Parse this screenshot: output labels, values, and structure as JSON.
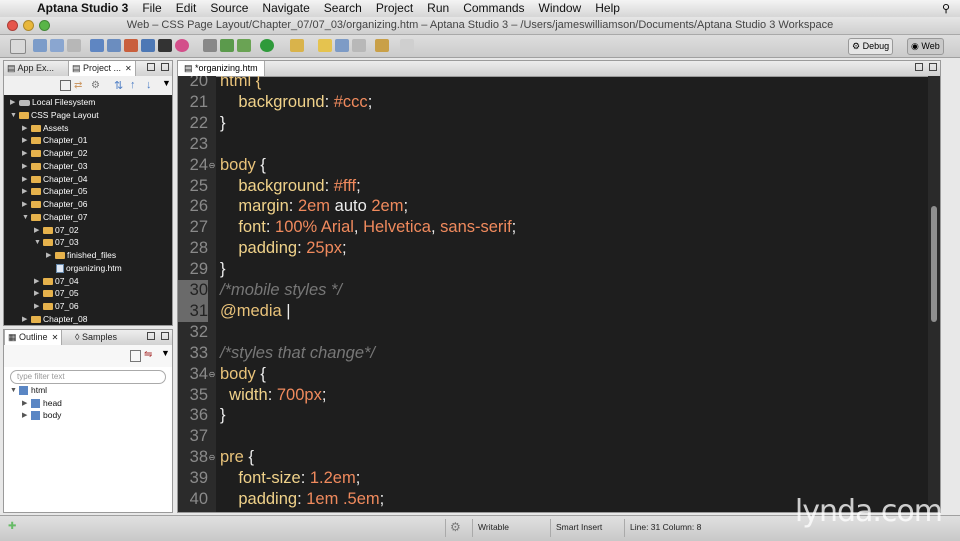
{
  "menubar": {
    "app_name": "Aptana Studio 3",
    "items": [
      "File",
      "Edit",
      "Source",
      "Navigate",
      "Search",
      "Project",
      "Run",
      "Commands",
      "Window",
      "Help"
    ]
  },
  "window": {
    "title": "Web – CSS Page Layout/Chapter_07/07_03/organizing.htm – Aptana Studio 3 – /Users/jameswilliamson/Documents/Aptana Studio 3 Workspace"
  },
  "perspectives": {
    "debug_label": "Debug",
    "web_label": "Web"
  },
  "left_panel": {
    "tabs": [
      {
        "label": "App Ex..."
      },
      {
        "label": "Project ..."
      }
    ],
    "tree": [
      {
        "label": "Local Filesystem",
        "type": "drive",
        "indent": 0,
        "arrow": "▶"
      },
      {
        "label": "CSS Page Layout",
        "type": "project",
        "indent": 0,
        "arrow": "▼"
      },
      {
        "label": "Assets",
        "type": "folder",
        "indent": 1,
        "arrow": "▶"
      },
      {
        "label": "Chapter_01",
        "type": "folder",
        "indent": 1,
        "arrow": "▶"
      },
      {
        "label": "Chapter_02",
        "type": "folder",
        "indent": 1,
        "arrow": "▶"
      },
      {
        "label": "Chapter_03",
        "type": "folder",
        "indent": 1,
        "arrow": "▶"
      },
      {
        "label": "Chapter_04",
        "type": "folder",
        "indent": 1,
        "arrow": "▶"
      },
      {
        "label": "Chapter_05",
        "type": "folder",
        "indent": 1,
        "arrow": "▶"
      },
      {
        "label": "Chapter_06",
        "type": "folder",
        "indent": 1,
        "arrow": "▶"
      },
      {
        "label": "Chapter_07",
        "type": "folder",
        "indent": 1,
        "arrow": "▼"
      },
      {
        "label": "07_02",
        "type": "folder",
        "indent": 2,
        "arrow": "▶"
      },
      {
        "label": "07_03",
        "type": "folder",
        "indent": 2,
        "arrow": "▼"
      },
      {
        "label": "finished_files",
        "type": "folder",
        "indent": 3,
        "arrow": "▶"
      },
      {
        "label": "organizing.htm",
        "type": "file",
        "indent": 3,
        "arrow": ""
      },
      {
        "label": "07_04",
        "type": "folder",
        "indent": 2,
        "arrow": "▶"
      },
      {
        "label": "07_05",
        "type": "folder",
        "indent": 2,
        "arrow": "▶"
      },
      {
        "label": "07_06",
        "type": "folder",
        "indent": 2,
        "arrow": "▶"
      },
      {
        "label": "Chapter_08",
        "type": "folder",
        "indent": 1,
        "arrow": "▶"
      }
    ]
  },
  "outline_panel": {
    "tabs": [
      {
        "label": "Outline"
      },
      {
        "label": "Samples"
      }
    ],
    "filter_placeholder": "type filter text",
    "tree": [
      {
        "label": "html",
        "indent": 0,
        "arrow": "▼"
      },
      {
        "label": "head",
        "indent": 1,
        "arrow": "▶"
      },
      {
        "label": "body",
        "indent": 1,
        "arrow": "▶"
      }
    ]
  },
  "editor": {
    "tab_label": "*organizing.htm",
    "lines": [
      {
        "num": "20",
        "fold": "",
        "tokens": [
          {
            "t": "html {",
            "c": "c-sel"
          }
        ]
      },
      {
        "num": "21",
        "fold": "",
        "tokens": [
          {
            "t": "    background",
            "c": "c-prop"
          },
          {
            "t": ": ",
            "c": ""
          },
          {
            "t": "#ccc",
            "c": "c-val"
          },
          {
            "t": ";",
            "c": ""
          }
        ]
      },
      {
        "num": "22",
        "fold": "",
        "tokens": [
          {
            "t": "}",
            "c": ""
          }
        ]
      },
      {
        "num": "23",
        "fold": "",
        "tokens": []
      },
      {
        "num": "24",
        "fold": "⊖",
        "tokens": [
          {
            "t": "body",
            "c": "c-sel"
          },
          {
            "t": " {",
            "c": ""
          }
        ]
      },
      {
        "num": "25",
        "fold": "",
        "tokens": [
          {
            "t": "    background",
            "c": "c-prop"
          },
          {
            "t": ": ",
            "c": ""
          },
          {
            "t": "#fff",
            "c": "c-val"
          },
          {
            "t": ";",
            "c": ""
          }
        ]
      },
      {
        "num": "26",
        "fold": "",
        "tokens": [
          {
            "t": "    margin",
            "c": "c-prop"
          },
          {
            "t": ": ",
            "c": ""
          },
          {
            "t": "2em",
            "c": "c-val"
          },
          {
            "t": " auto ",
            "c": ""
          },
          {
            "t": "2em",
            "c": "c-val"
          },
          {
            "t": ";",
            "c": ""
          }
        ]
      },
      {
        "num": "27",
        "fold": "",
        "tokens": [
          {
            "t": "    font",
            "c": "c-prop"
          },
          {
            "t": ": ",
            "c": ""
          },
          {
            "t": "100% Arial",
            "c": "c-val"
          },
          {
            "t": ", ",
            "c": ""
          },
          {
            "t": "Helvetica",
            "c": "c-val"
          },
          {
            "t": ", ",
            "c": ""
          },
          {
            "t": "sans-serif",
            "c": "c-val"
          },
          {
            "t": ";",
            "c": ""
          }
        ]
      },
      {
        "num": "28",
        "fold": "",
        "tokens": [
          {
            "t": "    padding",
            "c": "c-prop"
          },
          {
            "t": ": ",
            "c": ""
          },
          {
            "t": "25px",
            "c": "c-val"
          },
          {
            "t": ";",
            "c": ""
          }
        ]
      },
      {
        "num": "29",
        "fold": "",
        "tokens": [
          {
            "t": "}",
            "c": ""
          }
        ]
      },
      {
        "num": "30",
        "fold": "",
        "hl": true,
        "tokens": [
          {
            "t": "/*mobile styles */",
            "c": "c-cmt"
          }
        ]
      },
      {
        "num": "31",
        "fold": "",
        "hl": true,
        "tokens": [
          {
            "t": "@media ",
            "c": "c-at"
          },
          {
            "t": "|",
            "c": ""
          }
        ]
      },
      {
        "num": "32",
        "fold": "",
        "tokens": []
      },
      {
        "num": "33",
        "fold": "",
        "tokens": [
          {
            "t": "/*styles that change*/",
            "c": "c-cmt"
          }
        ]
      },
      {
        "num": "34",
        "fold": "⊖",
        "tokens": [
          {
            "t": "body",
            "c": "c-sel"
          },
          {
            "t": " {",
            "c": ""
          }
        ]
      },
      {
        "num": "35",
        "fold": "",
        "tokens": [
          {
            "t": "  width",
            "c": "c-prop"
          },
          {
            "t": ": ",
            "c": ""
          },
          {
            "t": "700px",
            "c": "c-val"
          },
          {
            "t": ";",
            "c": ""
          }
        ]
      },
      {
        "num": "36",
        "fold": "",
        "tokens": [
          {
            "t": "}",
            "c": ""
          }
        ]
      },
      {
        "num": "37",
        "fold": "",
        "tokens": []
      },
      {
        "num": "38",
        "fold": "⊖",
        "tokens": [
          {
            "t": "pre",
            "c": "c-sel"
          },
          {
            "t": " {",
            "c": ""
          }
        ]
      },
      {
        "num": "39",
        "fold": "",
        "tokens": [
          {
            "t": "    font-size",
            "c": "c-prop"
          },
          {
            "t": ": ",
            "c": ""
          },
          {
            "t": "1.2em",
            "c": "c-val"
          },
          {
            "t": ";",
            "c": ""
          }
        ]
      },
      {
        "num": "40",
        "fold": "",
        "tokens": [
          {
            "t": "    padding",
            "c": "c-prop"
          },
          {
            "t": ": ",
            "c": ""
          },
          {
            "t": "1em",
            "c": "c-val"
          },
          {
            "t": " ",
            "c": ""
          },
          {
            "t": ".5em",
            "c": "c-val"
          },
          {
            "t": ";",
            "c": ""
          }
        ]
      }
    ]
  },
  "status": {
    "writable": "Writable",
    "insert_mode": "Smart Insert",
    "position": "Line: 31 Column: 8"
  },
  "watermark": "lynda.com"
}
